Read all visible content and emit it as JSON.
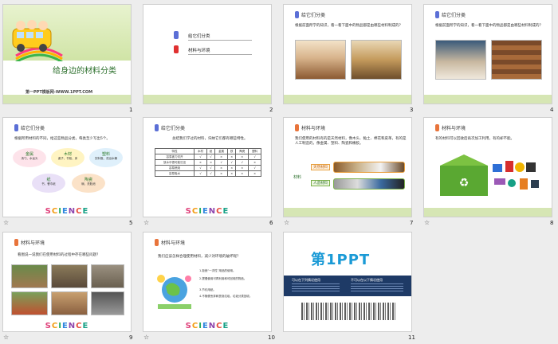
{
  "slides": [
    {
      "num": "1",
      "title": "给身边的材料分类",
      "footer": "第一PPT模板网-WWW.1PPT.COM"
    },
    {
      "num": "2",
      "items": [
        "给它们分类",
        "材料与环境"
      ]
    },
    {
      "num": "3",
      "header": "给它们分类",
      "text": "根据前面所学的知识，看一看下面中的物品都是由哪些材料制成的？"
    },
    {
      "num": "4",
      "header": "给它们分类",
      "text": "根据前面所学的知识，看一看下面中的物品都是由哪些材料制成的？"
    },
    {
      "num": "5",
      "header": "给它们分类",
      "text": "根据所用材料的不同，给这些物品分类，每类至少写出5个。",
      "groups": [
        {
          "name": "金属",
          "items": "汤勺、水龙头"
        },
        {
          "name": "木材",
          "items": "桌子、书柜、床"
        },
        {
          "name": "塑料",
          "items": "饮料瓶、洗浴水桶"
        },
        {
          "name": "纸",
          "items": "书、餐巾纸"
        },
        {
          "name": "陶瓷",
          "items": "碗、洗脸池"
        }
      ]
    },
    {
      "num": "6",
      "header": "给它们分类",
      "text": "总结我们学过的材料，归纳它们都有哪些特性。",
      "table": {
        "headers": [
          "特性",
          "木材",
          "纸",
          "金属",
          "铁",
          "陶瓷",
          "塑料"
        ],
        "rows": [
          [
            "容易被刀切开",
            true,
            true,
            false,
            false,
            false,
            true
          ],
          [
            "放水中很可能沉没",
            false,
            false,
            true,
            true,
            true,
            false
          ],
          [
            "容易燃烧",
            true,
            true,
            false,
            false,
            false,
            true
          ],
          [
            "容易吸水",
            true,
            true,
            false,
            false,
            false,
            false
          ]
        ]
      }
    },
    {
      "num": "7",
      "header": "材料与环境",
      "text": "我们使用的材料有的是天然材料，像木头、黏土、棉花和皮革，有的是人工制造的，像金属、塑料、陶瓷和橡胶。",
      "labels": {
        "root": "材料",
        "natural": "天然材料",
        "manmade": "人造材料"
      }
    },
    {
      "num": "8",
      "header": "材料与环境",
      "text": "有的材料可以回收后再次加工利用，有的却不能。"
    },
    {
      "num": "9",
      "header": "材料与环境",
      "text": "看图说一说我们在使用材料的过程中存在哪些问题？"
    },
    {
      "num": "10",
      "header": "材料与环境",
      "text": "我们应该怎样合理使用材料，减少对环境的破坏呢？",
      "tips": [
        "1.拒绝“一次性”用品的使用。",
        "2.提倡使用可再利用和可回收的物品。",
        "3.节约用纸。",
        "4.不随便丢弃和焚烧垃圾，垃圾分类回收。"
      ]
    },
    {
      "num": "11",
      "logo": "第1PPT",
      "banner_left": "可以在下列情况使用",
      "banner_right": "不可以在以下情况使用"
    }
  ],
  "colors": {
    "bar": "#d6e6b4",
    "accent": "#e8743b",
    "blue_pin": "#5b6fd6"
  },
  "star_icon": "☆",
  "science": "SCIENCE"
}
